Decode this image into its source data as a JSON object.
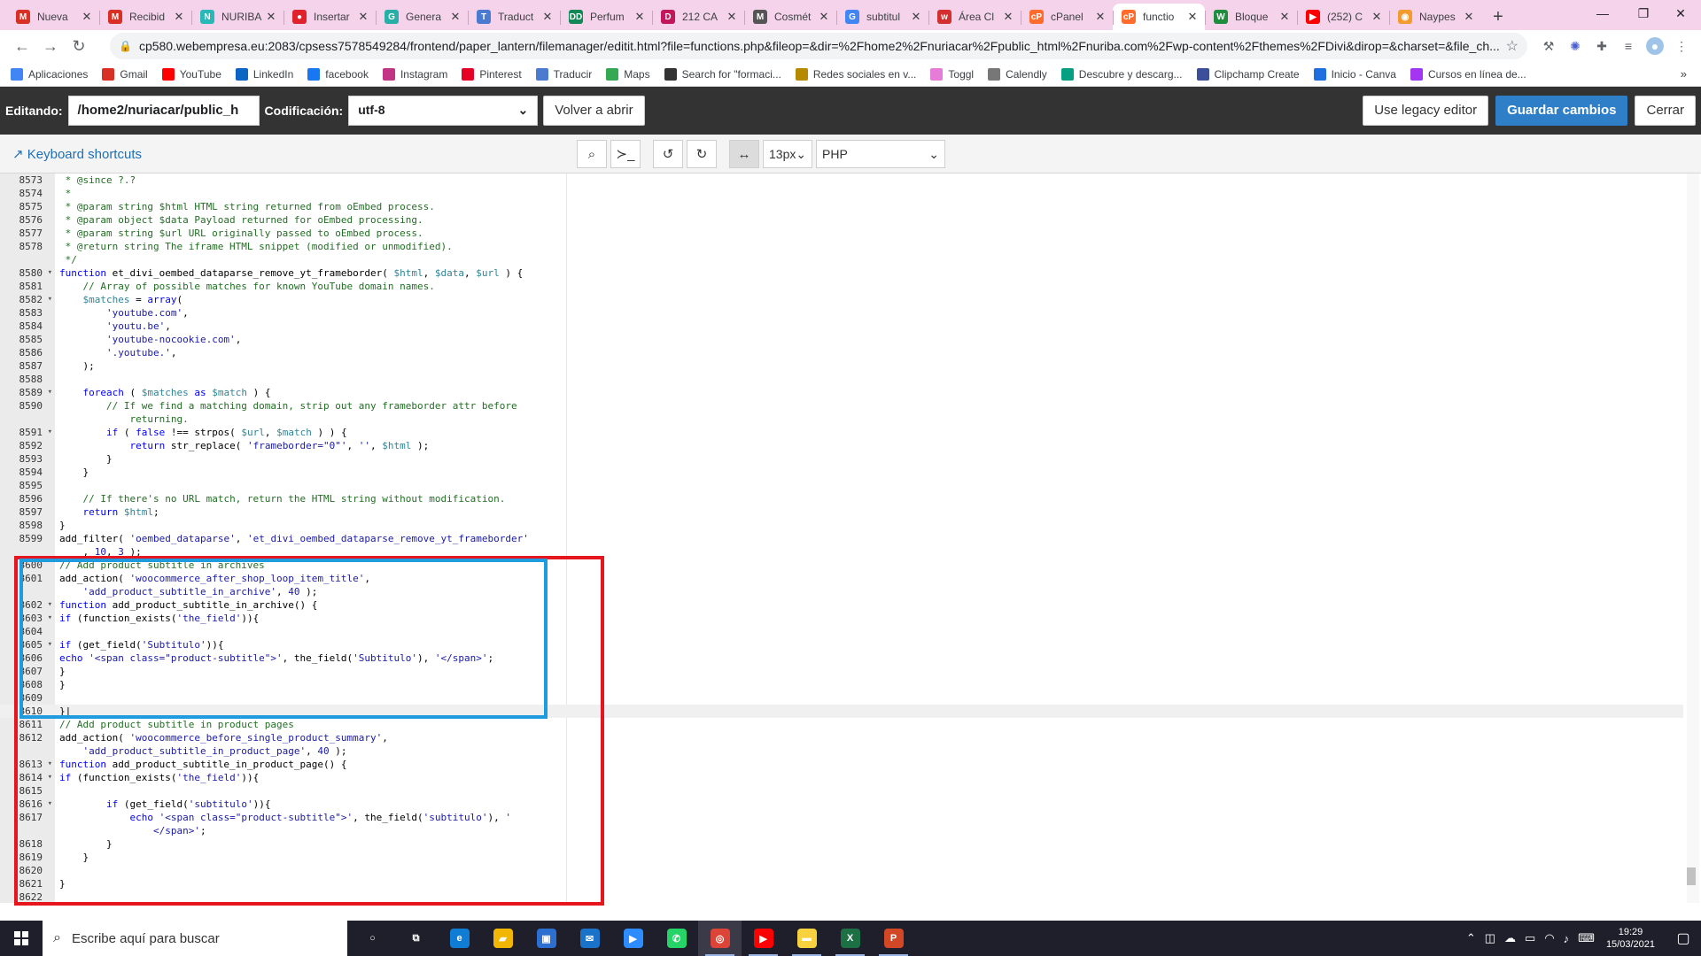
{
  "browser": {
    "tabs": [
      {
        "label": "Nueva",
        "icon": "gmail-icon",
        "color": "#d93025",
        "glyph": "M"
      },
      {
        "label": "Recibid",
        "icon": "gmail-icon",
        "color": "#d93025",
        "glyph": "M"
      },
      {
        "label": "NURIBA",
        "icon": "nuriba-icon",
        "color": "#2ab7b7",
        "glyph": "N"
      },
      {
        "label": "Insertar",
        "icon": "red-circle-icon",
        "color": "#e0222c",
        "glyph": "●"
      },
      {
        "label": "Genera",
        "icon": "teal-swirl-icon",
        "color": "#28b0a6",
        "glyph": "G"
      },
      {
        "label": "Traduct",
        "icon": "translate-icon",
        "color": "#4a7bd0",
        "glyph": "T"
      },
      {
        "label": "Perfum",
        "icon": "dd-icon",
        "color": "#118856",
        "glyph": "DD"
      },
      {
        "label": "212 CA",
        "icon": "d-icon",
        "color": "#c2185b",
        "glyph": "D"
      },
      {
        "label": "Cosmét",
        "icon": "gmail-icon",
        "color": "#555555",
        "glyph": "M"
      },
      {
        "label": "subtitul",
        "icon": "google-icon",
        "color": "#4285f4",
        "glyph": "G"
      },
      {
        "label": "Área Cl",
        "icon": "webempresa-icon",
        "color": "#d32f2f",
        "glyph": "w"
      },
      {
        "label": "cPanel",
        "icon": "cpanel-icon",
        "color": "#ff6c2c",
        "glyph": "cP"
      },
      {
        "label": "functio",
        "icon": "cpanel-icon",
        "color": "#ff6c2c",
        "glyph": "cP"
      },
      {
        "label": "Bloque",
        "icon": "wordpress-icon",
        "color": "#1e8e3e",
        "glyph": "W"
      },
      {
        "label": "(252) C",
        "icon": "youtube-icon",
        "color": "#ff0000",
        "glyph": "▶"
      },
      {
        "label": "Naypes",
        "icon": "orange-icon",
        "color": "#f29b2f",
        "glyph": "◉"
      }
    ],
    "active_tab_index": 12,
    "url": "cp580.webempresa.eu:2083/cpsess7578549284/frontend/paper_lantern/filemanager/editit.html?file=functions.php&fileop=&dir=%2Fhome2%2Fnuriacar%2Fpublic_html%2Fnuriba.com%2Fwp-content%2Fthemes%2FDivi&dirop=&charset=&file_ch...",
    "bookmarks": [
      {
        "label": "Aplicaciones",
        "icon": "apps-grid-icon",
        "color": "#4285f4"
      },
      {
        "label": "Gmail",
        "icon": "gmail-icon",
        "color": "#d93025"
      },
      {
        "label": "YouTube",
        "icon": "youtube-icon",
        "color": "#ff0000"
      },
      {
        "label": "LinkedIn",
        "icon": "linkedin-icon",
        "color": "#0a66c2"
      },
      {
        "label": "facebook",
        "icon": "facebook-icon",
        "color": "#1877f2"
      },
      {
        "label": "Instagram",
        "icon": "instagram-icon",
        "color": "#c13584"
      },
      {
        "label": "Pinterest",
        "icon": "pinterest-icon",
        "color": "#e60023"
      },
      {
        "label": "Traducir",
        "icon": "translate-icon",
        "color": "#4a7bd0"
      },
      {
        "label": "Maps",
        "icon": "maps-icon",
        "color": "#34a853"
      },
      {
        "label": "Search for \"formaci...",
        "icon": "globe-icon",
        "color": "#333333"
      },
      {
        "label": "Redes sociales en v...",
        "icon": "redes-icon",
        "color": "#b58900"
      },
      {
        "label": "Toggl",
        "icon": "toggl-icon",
        "color": "#e57cd8"
      },
      {
        "label": "Calendly",
        "icon": "calendly-icon",
        "color": "#777777"
      },
      {
        "label": "Descubre y descarg...",
        "icon": "px-icon",
        "color": "#05a081"
      },
      {
        "label": "Clipchamp Create",
        "icon": "clipchamp-icon",
        "color": "#3c4f9a"
      },
      {
        "label": "Inicio - Canva",
        "icon": "canva-icon",
        "color": "#1f6fe0"
      },
      {
        "label": "Cursos en línea de...",
        "icon": "udemy-icon",
        "color": "#a435f0"
      }
    ]
  },
  "editor": {
    "editing_label": "Editando:",
    "path_value": "/home2/nuriacar/public_h",
    "encoding_label": "Codificación:",
    "encoding_value": "utf-8",
    "reopen_button": "Volver a abrir",
    "legacy_button": "Use legacy editor",
    "save_button": "Guardar cambios",
    "close_button": "Cerrar",
    "keyboard_shortcuts": "Keyboard shortcuts",
    "font_size": "13px",
    "mode": "PHP",
    "colors": {
      "accent": "#2f7fc8",
      "highlight_red": "#e5161d",
      "highlight_blue": "#1f9be0"
    }
  },
  "code_lines": [
    {
      "n": "8573",
      "fold": false,
      "html": "<span class='c-cm'> * @since ?.?</span>"
    },
    {
      "n": "8574",
      "fold": false,
      "html": "<span class='c-cm'> *</span>"
    },
    {
      "n": "8575",
      "fold": false,
      "html": "<span class='c-cm'> * @param string $html HTML string returned from oEmbed process.</span>"
    },
    {
      "n": "8576",
      "fold": false,
      "html": "<span class='c-cm'> * @param object $data Payload returned for oEmbed processing.</span>"
    },
    {
      "n": "8577",
      "fold": false,
      "html": "<span class='c-cm'> * @param string $url URL originally passed to oEmbed process.</span>"
    },
    {
      "n": "8578",
      "fold": false,
      "html": "<span class='c-cm'> * @return string The iframe HTML snippet (modified or unmodified).</span>"
    },
    {
      "n": "",
      "fold": false,
      "html": "<span class='c-cm'> */</span>"
    },
    {
      "n": "8580",
      "fold": true,
      "html": "<span class='c-kw'>function</span> et_divi_oembed_dataparse_remove_yt_frameborder( <span class='c-vr'>$html</span>, <span class='c-vr'>$data</span>, <span class='c-vr'>$url</span> ) {"
    },
    {
      "n": "8581",
      "fold": false,
      "html": "    <span class='c-cm'>// Array of possible matches for known YouTube domain names.</span>"
    },
    {
      "n": "8582",
      "fold": true,
      "html": "    <span class='c-vr'>$matches</span> = <span class='c-kw'>array</span>("
    },
    {
      "n": "8583",
      "fold": false,
      "html": "        <span class='c-st'>'youtube.com'</span>,"
    },
    {
      "n": "8584",
      "fold": false,
      "html": "        <span class='c-st'>'youtu.be'</span>,"
    },
    {
      "n": "8585",
      "fold": false,
      "html": "        <span class='c-st'>'youtube-nocookie.com'</span>,"
    },
    {
      "n": "8586",
      "fold": false,
      "html": "        <span class='c-st'>'.youtube.'</span>,"
    },
    {
      "n": "8587",
      "fold": false,
      "html": "    );"
    },
    {
      "n": "8588",
      "fold": false,
      "html": ""
    },
    {
      "n": "8589",
      "fold": true,
      "html": "    <span class='c-kw'>foreach</span> ( <span class='c-vr'>$matches</span> <span class='c-kw'>as</span> <span class='c-vr'>$match</span> ) {"
    },
    {
      "n": "8590",
      "fold": false,
      "html": "        <span class='c-cm'>// If we find a matching domain, strip out any frameborder attr before</span>"
    },
    {
      "n": "",
      "fold": false,
      "html": "<span class='c-cm'>            returning.</span>"
    },
    {
      "n": "8591",
      "fold": true,
      "html": "        <span class='c-kw'>if</span> ( <span class='c-kw'>false</span> !== strpos( <span class='c-vr'>$url</span>, <span class='c-vr'>$match</span> ) ) {"
    },
    {
      "n": "8592",
      "fold": false,
      "html": "            <span class='c-kw'>return</span> str_replace( <span class='c-st'>'frameborder=\"0\"'</span>, <span class='c-st'>''</span>, <span class='c-vr'>$html</span> );"
    },
    {
      "n": "8593",
      "fold": false,
      "html": "        }"
    },
    {
      "n": "8594",
      "fold": false,
      "html": "    }"
    },
    {
      "n": "8595",
      "fold": false,
      "html": ""
    },
    {
      "n": "8596",
      "fold": false,
      "html": "    <span class='c-cm'>// If there's no URL match, return the HTML string without modification.</span>"
    },
    {
      "n": "8597",
      "fold": false,
      "html": "    <span class='c-kw'>return</span> <span class='c-vr'>$html</span>;"
    },
    {
      "n": "8598",
      "fold": false,
      "html": "}"
    },
    {
      "n": "8599",
      "fold": false,
      "html": "add_filter( <span class='c-st'>'oembed_dataparse'</span>, <span class='c-st'>'et_divi_oembed_dataparse_remove_yt_frameborder'</span>"
    },
    {
      "n": "",
      "fold": false,
      "html": "    , <span class='c-st'>10</span>, <span class='c-st'>3</span> );"
    },
    {
      "n": "8600",
      "fold": false,
      "html": "<span class='c-cm'>// Add product subtitle in archives</span>"
    },
    {
      "n": "8601",
      "fold": false,
      "html": "add_action( <span class='c-st'>'woocommerce_after_shop_loop_item_title'</span>,"
    },
    {
      "n": "",
      "fold": false,
      "html": "    <span class='c-st'>'add_product_subtitle_in_archive'</span>, <span class='c-st'>40</span> );"
    },
    {
      "n": "8602",
      "fold": true,
      "html": "<span class='c-kw'>function</span> add_product_subtitle_in_archive() {"
    },
    {
      "n": "8603",
      "fold": true,
      "html": "<span class='c-kw'>if</span> (function_exists(<span class='c-st'>'the_field'</span>)){"
    },
    {
      "n": "8604",
      "fold": false,
      "html": ""
    },
    {
      "n": "8605",
      "fold": true,
      "html": "<span class='c-kw'>if</span> (get_field(<span class='c-st'>'Subtitulo'</span>)){"
    },
    {
      "n": "8606",
      "fold": false,
      "html": "<span class='c-kw'>echo</span> <span class='c-st'>'&lt;span class=\"product-subtitle\"&gt;'</span>, the_field(<span class='c-st'>'Subtitulo'</span>), <span class='c-st'>'&lt;/span&gt;'</span>;"
    },
    {
      "n": "8607",
      "fold": false,
      "html": "}"
    },
    {
      "n": "8608",
      "fold": false,
      "html": "}"
    },
    {
      "n": "8609",
      "fold": false,
      "html": ""
    },
    {
      "n": "8610",
      "fold": false,
      "cursor": true,
      "html": "}|"
    },
    {
      "n": "8611",
      "fold": false,
      "html": "<span class='c-cm'>// Add product subtitle in product pages</span>"
    },
    {
      "n": "8612",
      "fold": false,
      "html": "add_action( <span class='c-st'>'woocommerce_before_single_product_summary'</span>,"
    },
    {
      "n": "",
      "fold": false,
      "html": "    <span class='c-st'>'add_product_subtitle_in_product_page'</span>, <span class='c-st'>40</span> );"
    },
    {
      "n": "8613",
      "fold": true,
      "html": "<span class='c-kw'>function</span> add_product_subtitle_in_product_page() {"
    },
    {
      "n": "8614",
      "fold": true,
      "html": "<span class='c-kw'>if</span> (function_exists(<span class='c-st'>'the_field'</span>)){"
    },
    {
      "n": "8615",
      "fold": false,
      "html": ""
    },
    {
      "n": "8616",
      "fold": true,
      "html": "        <span class='c-kw'>if</span> (get_field(<span class='c-st'>'subtitulo'</span>)){"
    },
    {
      "n": "8617",
      "fold": false,
      "html": "            <span class='c-kw'>echo</span> <span class='c-st'>'&lt;span class=\"product-subtitle\"&gt;'</span>, the_field(<span class='c-st'>'subtitulo'</span>), <span class='c-st'>'</span>"
    },
    {
      "n": "",
      "fold": false,
      "html": "<span class='c-st'>                &lt;/span&gt;'</span>;"
    },
    {
      "n": "8618",
      "fold": false,
      "html": "        }"
    },
    {
      "n": "8619",
      "fold": false,
      "html": "    }"
    },
    {
      "n": "8620",
      "fold": false,
      "html": ""
    },
    {
      "n": "8621",
      "fold": false,
      "html": "}"
    },
    {
      "n": "8622",
      "fold": false,
      "html": ""
    }
  ],
  "taskbar": {
    "search_placeholder": "Escribe aquí para buscar",
    "apps": [
      {
        "icon": "cortana-icon",
        "color": "#1f1f2b",
        "glyph": "○",
        "run": false
      },
      {
        "icon": "task-view-icon",
        "color": "#1f1f2b",
        "glyph": "⧉",
        "run": false
      },
      {
        "icon": "edge-icon",
        "color": "#0f7dd6",
        "glyph": "e",
        "run": false
      },
      {
        "icon": "file-explorer-icon",
        "color": "#f2b705",
        "glyph": "▰",
        "run": false
      },
      {
        "icon": "store-icon",
        "color": "#2d6fd1",
        "glyph": "▣",
        "run": false
      },
      {
        "icon": "mail-icon",
        "color": "#1a73c9",
        "glyph": "✉",
        "run": false
      },
      {
        "icon": "zoom-icon",
        "color": "#2d8cff",
        "glyph": "▶",
        "run": false
      },
      {
        "icon": "whatsapp-icon",
        "color": "#25d366",
        "glyph": "✆",
        "run": false
      },
      {
        "icon": "chrome-icon",
        "color": "#db4437",
        "glyph": "◎",
        "run": true,
        "active": true
      },
      {
        "icon": "youtube-music-icon",
        "color": "#ff0000",
        "glyph": "▶",
        "run": true
      },
      {
        "icon": "sticky-notes-icon",
        "color": "#f7d23e",
        "glyph": "▬",
        "run": true
      },
      {
        "icon": "excel-icon",
        "color": "#1d7044",
        "glyph": "X",
        "run": true
      },
      {
        "icon": "powerpoint-icon",
        "color": "#d24726",
        "glyph": "P",
        "run": true
      }
    ],
    "time": "19:29",
    "date": "15/03/2021"
  }
}
